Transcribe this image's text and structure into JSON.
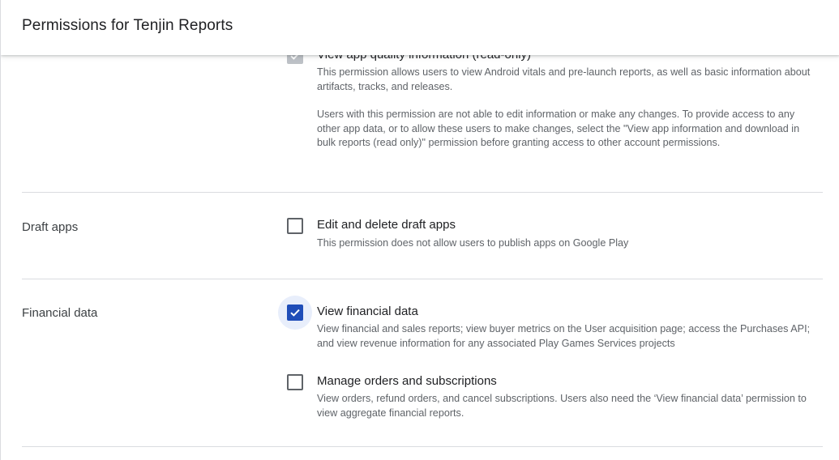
{
  "header": {
    "title": "Permissions for Tenjin Reports"
  },
  "sections": {
    "app_quality": {
      "permission": {
        "title": "View app quality information (read-only)",
        "checked": true,
        "disabled": true,
        "desc_1": "This permission allows users to view Android vitals and pre-launch reports, as well as basic information about artifacts, tracks, and releases.",
        "desc_2": "Users with this permission are not able to edit information or make any changes. To provide access to any other app data, or to allow these users to make changes, select the \"View app information and download in bulk reports (read only)\" permission before granting access to other account permissions."
      }
    },
    "draft_apps": {
      "label": "Draft apps",
      "permission": {
        "title": "Edit and delete draft apps",
        "checked": false,
        "desc": "This permission does not allow users to publish apps on Google Play"
      }
    },
    "financial_data": {
      "label": "Financial data",
      "permissions": [
        {
          "title": "View financial data",
          "checked": true,
          "desc": "View financial and sales reports; view buyer metrics on the User acquisition page; access the Purchases API; and view revenue information for any associated Play Games Services projects"
        },
        {
          "title": "Manage orders and subscriptions",
          "checked": false,
          "desc": "View orders, refund orders, and cancel subscriptions. Users also need the ‘View financial data’ permission to view aggregate financial reports."
        }
      ]
    }
  },
  "colors": {
    "accent": "#1f4db8",
    "focus_halo": "#e8eefb",
    "disabled": "#bdc1c6",
    "divider": "#dadce0"
  }
}
